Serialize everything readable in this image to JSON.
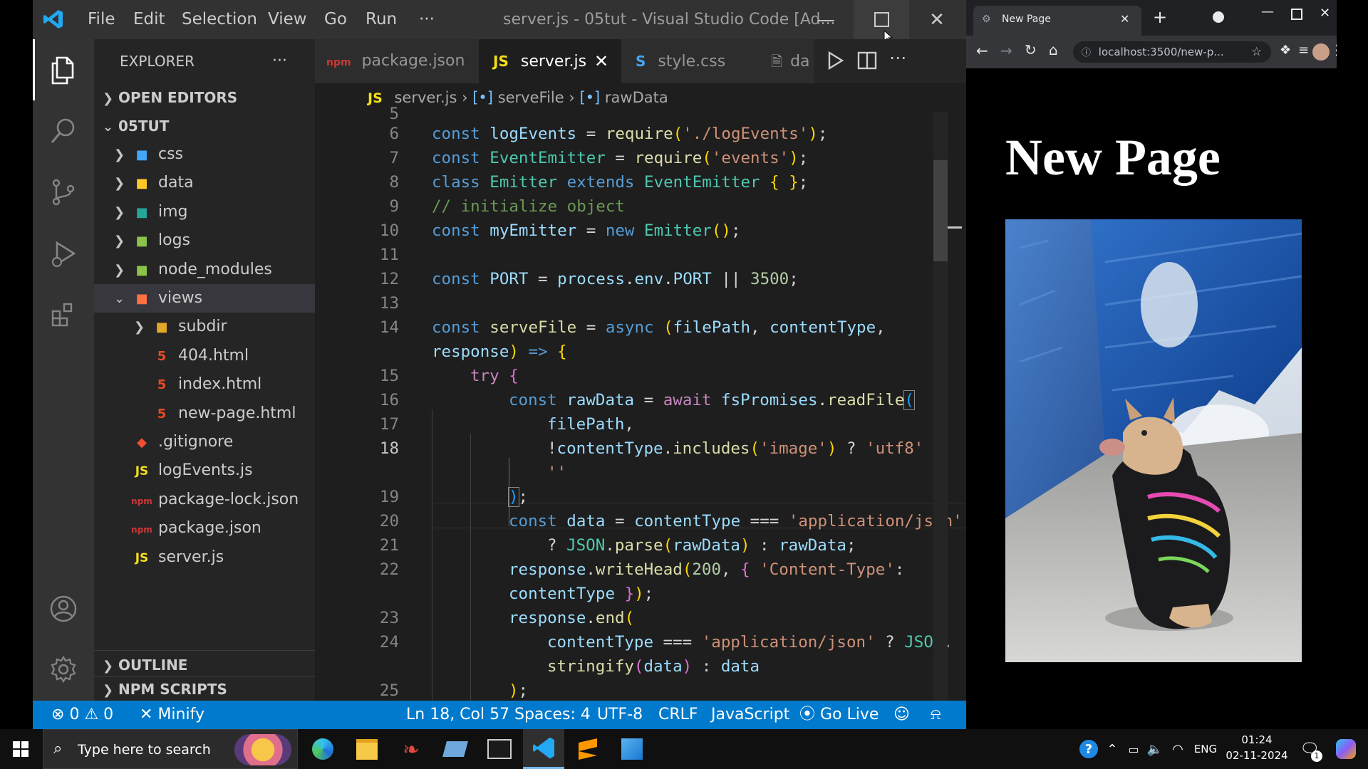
{
  "vscode": {
    "window_title": "server.js - 05tut - Visual Studio Code [Ad...",
    "menu": [
      "File",
      "Edit",
      "Selection",
      "View",
      "Go",
      "Run",
      "···"
    ],
    "sidebar": {
      "title": "EXPLORER",
      "more": "···",
      "open_editors": "OPEN EDITORS",
      "project": "05TUT",
      "tree": [
        {
          "label": "css",
          "kind": "folder",
          "icon": "css-folder-icon",
          "color": "#42a5f5"
        },
        {
          "label": "data",
          "kind": "folder",
          "icon": "data-folder-icon",
          "color": "#ffca28"
        },
        {
          "label": "img",
          "kind": "folder",
          "icon": "img-folder-icon",
          "color": "#26a69a"
        },
        {
          "label": "logs",
          "kind": "folder",
          "icon": "logs-folder-icon",
          "color": "#8bc34a"
        },
        {
          "label": "node_modules",
          "kind": "folder",
          "icon": "node-folder-icon",
          "color": "#8bc34a"
        },
        {
          "label": "views",
          "kind": "folder-open",
          "icon": "views-folder-icon",
          "color": "#ff7043"
        },
        {
          "label": "subdir",
          "kind": "folder",
          "icon": "subdir-folder-icon",
          "color": "#e3a72a"
        },
        {
          "label": "404.html",
          "kind": "html",
          "icon": "html-file-icon",
          "color": "#e44d26"
        },
        {
          "label": "index.html",
          "kind": "html",
          "icon": "html-file-icon",
          "color": "#e44d26"
        },
        {
          "label": "new-page.html",
          "kind": "html",
          "icon": "html-file-icon",
          "color": "#e44d26"
        },
        {
          "label": ".gitignore",
          "kind": "git",
          "icon": "git-file-icon",
          "color": "#f14e32"
        },
        {
          "label": "logEvents.js",
          "kind": "js",
          "icon": "js-file-icon",
          "color": "#f5de19"
        },
        {
          "label": "package-lock.json",
          "kind": "npm",
          "icon": "npm-file-icon",
          "color": "#cb3837"
        },
        {
          "label": "package.json",
          "kind": "npm",
          "icon": "npm-file-icon",
          "color": "#cb3837"
        },
        {
          "label": "server.js",
          "kind": "js",
          "icon": "js-file-icon",
          "color": "#f5de19"
        }
      ],
      "outline": "OUTLINE",
      "npm_scripts": "NPM SCRIPTS"
    },
    "tabs": [
      {
        "label": "package.json",
        "icon": "npm-file-icon"
      },
      {
        "label": "server.js",
        "icon": "js-file-icon",
        "active": true
      },
      {
        "label": "style.css",
        "icon": "css-file-icon"
      },
      {
        "label": "da",
        "icon": "file-icon"
      }
    ],
    "breadcrumb": {
      "file": "server.js",
      "fn": "serveFile",
      "var": "rawData",
      "js": "JS"
    },
    "line_numbers": [
      "5",
      "6",
      "7",
      "8",
      "9",
      "10",
      "11",
      "12",
      "13",
      "14",
      "",
      "15",
      "16",
      "17",
      "18",
      "",
      "19",
      "20",
      "21",
      "22",
      "",
      "23",
      "24",
      "",
      "25"
    ],
    "status": {
      "errors": "0",
      "warnings": "0",
      "minify": "Minify",
      "position": "Ln 18, Col 57",
      "spaces": "Spaces: 4",
      "encoding": "UTF-8",
      "eol": "CRLF",
      "language": "JavaScript",
      "golive": "Go Live"
    }
  },
  "browser": {
    "tab_title": "New Page",
    "url": "localhost:3500/new-p...",
    "heading": "New Page"
  },
  "taskbar": {
    "search_placeholder": "Type here to search",
    "lang": "ENG",
    "time": "01:24",
    "date": "02-11-2024",
    "notification_count": "1"
  }
}
